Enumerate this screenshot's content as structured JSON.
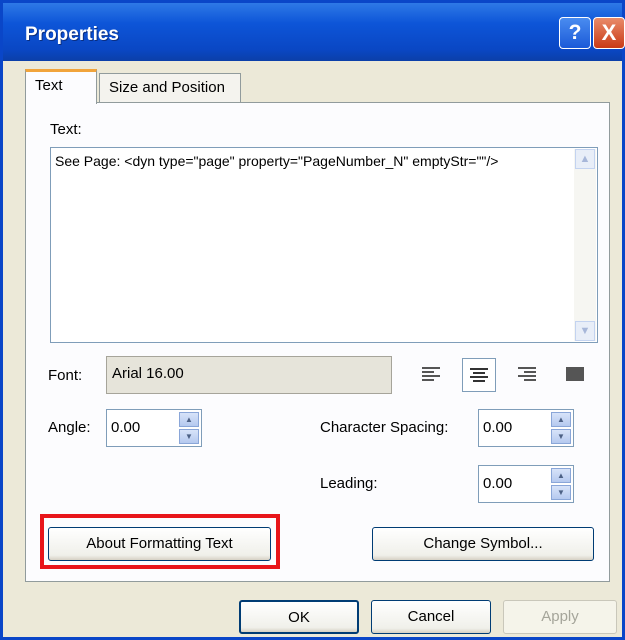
{
  "window": {
    "title": "Properties"
  },
  "title_buttons": {
    "help": "?",
    "close": "X"
  },
  "tabs": [
    {
      "label": "Text",
      "active": true
    },
    {
      "label": "Size and Position",
      "active": false
    }
  ],
  "text_section": {
    "label": "Text:",
    "content": "See Page: <dyn type=\"page\" property=\"PageNumber_N\" emptyStr=\"\"/>"
  },
  "font": {
    "label": "Font:",
    "value": "Arial 16.00"
  },
  "alignment": {
    "options": [
      "align-left",
      "align-center",
      "align-right",
      "justify"
    ],
    "selected": "align-center"
  },
  "angle": {
    "label": "Angle:",
    "value": "0.00"
  },
  "character_spacing": {
    "label": "Character Spacing:",
    "value": "0.00"
  },
  "leading": {
    "label": "Leading:",
    "value": "0.00"
  },
  "buttons": {
    "about_formatting": "About Formatting Text",
    "change_symbol": "Change Symbol...",
    "ok": "OK",
    "cancel": "Cancel",
    "apply": "Apply"
  },
  "highlight_color": "#e8151a"
}
